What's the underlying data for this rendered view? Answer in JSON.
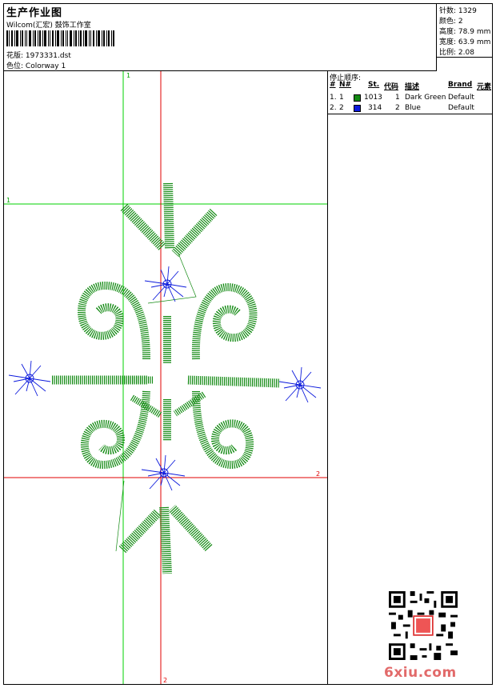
{
  "header": {
    "title": "生产作业图",
    "studio": "Wilcom(汇宏) 鼓饰工作室",
    "design_label": "花版:",
    "design_value": "1973331.dst",
    "colorway_label": "色位:",
    "colorway_value": "Colorway 1"
  },
  "stats": [
    {
      "label": "针数:",
      "value": "1329"
    },
    {
      "label": "颜色:",
      "value": "2"
    },
    {
      "label": "高度:",
      "value": "78.9 mm"
    },
    {
      "label": "宽度:",
      "value": "63.9 mm"
    },
    {
      "label": "比例:",
      "value": "2.08"
    }
  ],
  "stop_sequence": {
    "title": "停止顺序:",
    "columns": {
      "num": "#",
      "n": "N#",
      "st": "St.",
      "code": "代码",
      "desc": "描述",
      "brand": "Brand",
      "elem": "元素"
    },
    "rows": [
      {
        "num": "1.",
        "n": "1",
        "color": "#138a13",
        "st": "1013",
        "code": "1",
        "desc": "Dark Green",
        "brand": "Default"
      },
      {
        "num": "2.",
        "n": "2",
        "color": "#0b19dc",
        "st": "314",
        "code": "2",
        "desc": "Blue",
        "brand": "Default"
      }
    ]
  },
  "guides": {
    "green_v_label": "1",
    "green_h_label": "1",
    "red_h_label": "2",
    "red_v_label": "2"
  },
  "colors": {
    "green_thread": "#138a13",
    "blue_thread": "#0b19dc",
    "green_guide": "#00d000",
    "red_guide": "#e00000",
    "watermark": "#e26a6a"
  },
  "watermark": {
    "text": "6xiu.com",
    "qr_icon": "qr-code-icon",
    "seal_icon": "red-seal-icon"
  }
}
